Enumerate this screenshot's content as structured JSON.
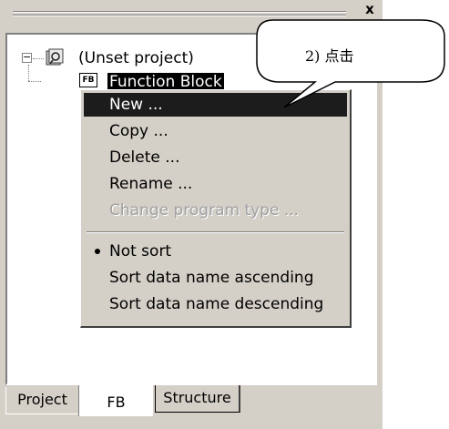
{
  "panel": {
    "close_glyph": "x",
    "close_icon": "close-icon"
  },
  "tree": {
    "expander_glyph": "−",
    "project_label": "(Unset project)",
    "project_icon": "project-icon",
    "fb_icon_text": "FB",
    "fb_label": "Function Block"
  },
  "context_menu": {
    "items": [
      {
        "label": "New ...",
        "state": "highlighted"
      },
      {
        "label": "Copy ..."
      },
      {
        "label": "Delete ..."
      },
      {
        "label": "Rename ..."
      },
      {
        "label": "Change program type ...",
        "state": "disabled"
      },
      {
        "label": "Not sort",
        "checked": true
      },
      {
        "label": "Sort data name ascending"
      },
      {
        "label": "Sort data name descending"
      }
    ]
  },
  "tabs": [
    {
      "label": "Project"
    },
    {
      "label": "FB",
      "selected": true
    },
    {
      "label": "Structure"
    }
  ],
  "callout": {
    "text": "2) 点击"
  },
  "colors": {
    "panel_bg": "#d4d0c8",
    "highlight_bg": "#1c1c1c",
    "disabled_text": "#a0a0a0"
  }
}
